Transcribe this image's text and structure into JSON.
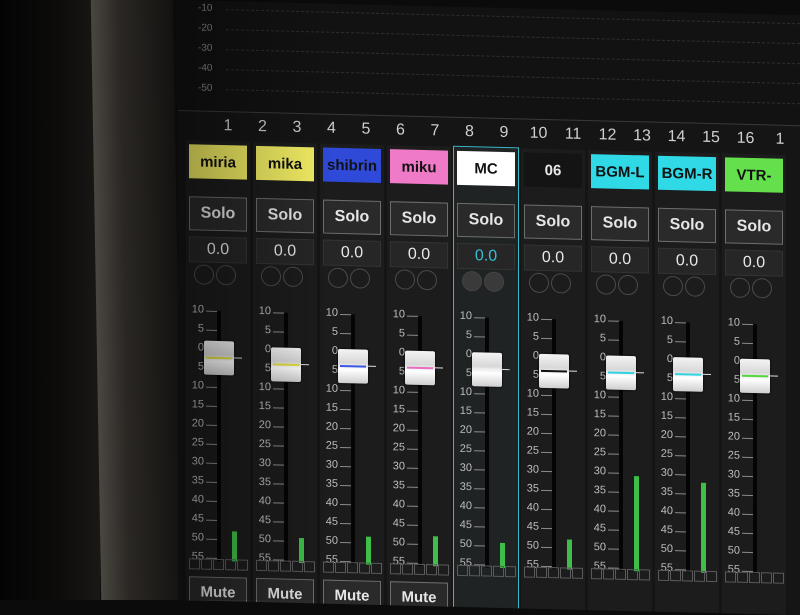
{
  "meter": {
    "db_labels": [
      "-10",
      "-20",
      "-30",
      "-40",
      "-50"
    ]
  },
  "channel_numbers": [
    "1",
    "2",
    "3",
    "4",
    "5",
    "6",
    "7",
    "8",
    "9",
    "10",
    "11",
    "12",
    "13",
    "14",
    "15",
    "16",
    "1"
  ],
  "fader_scale": [
    "10",
    "5",
    "0",
    "5",
    "10",
    "15",
    "20",
    "25",
    "30",
    "35",
    "40",
    "45",
    "50",
    "55"
  ],
  "channels": [
    {
      "name": "miria",
      "tag_bg": "#f3ee63",
      "tag_fg": "#111",
      "solo": "Solo",
      "gain": "0.0",
      "mark": "#e3df3a",
      "level": 0.12,
      "fader": 0.16,
      "mute": "Mute",
      "circles": "outline"
    },
    {
      "name": "mika",
      "tag_bg": "#f3ee63",
      "tag_fg": "#111",
      "solo": "Solo",
      "gain": "0.0",
      "mark": "#e3df3a",
      "level": 0.1,
      "fader": 0.18,
      "mute": "Mute",
      "circles": "outline"
    },
    {
      "name": "shibrin",
      "tag_bg": "#2f49d9",
      "tag_fg": "#111",
      "solo": "Solo",
      "gain": "0.0",
      "mark": "#3b57e5",
      "level": 0.11,
      "fader": 0.18,
      "mute": "Mute",
      "circles": "outline"
    },
    {
      "name": "miku",
      "tag_bg": "#ef7ac8",
      "tag_fg": "#111",
      "solo": "Solo",
      "gain": "0.0",
      "mark": "#e86cc3",
      "level": 0.12,
      "fader": 0.18,
      "mute": "Mute",
      "circles": "outline"
    },
    {
      "name": "MC",
      "tag_bg": "#ffffff",
      "tag_fg": "#111",
      "solo": "Solo",
      "gain": "0.0",
      "mark": "#f0f0f0",
      "level": 0.1,
      "fader": 0.18,
      "mute": "",
      "circles": "filled",
      "selected": true,
      "gain_color": "#35bfd0"
    },
    {
      "name": "06",
      "tag_bg": "#141414",
      "tag_fg": "#e8e8e8",
      "solo": "Solo",
      "gain": "0.0",
      "mark": "#111111",
      "level": 0.12,
      "fader": 0.18,
      "mute": "",
      "circles": "outline"
    },
    {
      "name": "BGM-L",
      "tag_bg": "#2fd9e6",
      "tag_fg": "#111",
      "solo": "Solo",
      "gain": "0.0",
      "mark": "#2fd3e0",
      "level": 0.38,
      "fader": 0.18,
      "mute": "",
      "circles": "outline"
    },
    {
      "name": "BGM-R",
      "tag_bg": "#2fd9e6",
      "tag_fg": "#111",
      "solo": "Solo",
      "gain": "0.0",
      "mark": "#2fd3e0",
      "level": 0.36,
      "fader": 0.18,
      "mute": "",
      "circles": "outline"
    },
    {
      "name": "VTR-",
      "tag_bg": "#63e04b",
      "tag_fg": "#111",
      "solo": "Solo",
      "gain": "0.0",
      "mark": "#55d63d",
      "level": 0.0,
      "fader": 0.18,
      "mute": "",
      "circles": "outline"
    }
  ]
}
